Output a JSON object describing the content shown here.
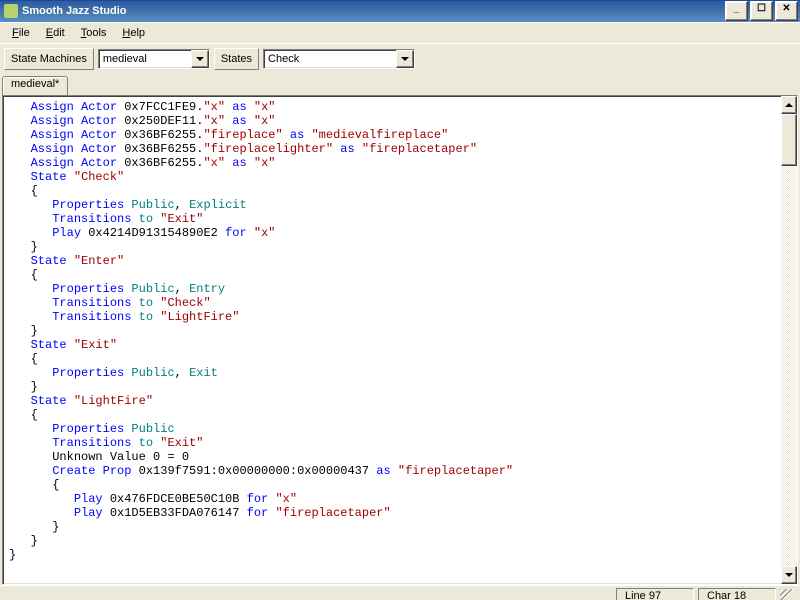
{
  "title": "Smooth Jazz Studio",
  "menus": {
    "file": "File",
    "edit": "Edit",
    "tools": "Tools",
    "help": "Help"
  },
  "toolbar": {
    "state_machines_label": "State Machines",
    "state_machines_value": "medieval",
    "states_label": "States",
    "states_value": "Check"
  },
  "tab": {
    "label": "medieval*"
  },
  "status": {
    "line": "Line 97",
    "char": "Char 18"
  },
  "code": {
    "l01a": "Assign Actor",
    "l01b": " 0x7FCC1FE9.",
    "l01c": "\"x\"",
    "l01d": " as ",
    "l01e": "\"x\"",
    "l02a": "Assign Actor",
    "l02b": " 0x250DEF11.",
    "l02c": "\"x\"",
    "l02d": " as ",
    "l02e": "\"x\"",
    "l03a": "Assign Actor",
    "l03b": " 0x36BF6255.",
    "l03c": "\"fireplace\"",
    "l03d": " as ",
    "l03e": "\"medievalfireplace\"",
    "l04a": "Assign Actor",
    "l04b": " 0x36BF6255.",
    "l04c": "\"fireplacelighter\"",
    "l04d": " as ",
    "l04e": "\"fireplacetaper\"",
    "l05a": "Assign Actor",
    "l05b": " 0x36BF6255.",
    "l05c": "\"x\"",
    "l05d": " as ",
    "l05e": "\"x\"",
    "l06a": "State",
    "l06b": " ",
    "l06c": "\"Check\"",
    "l07": "{",
    "l08a": "Properties",
    "l08b": " Public",
    "l08c": ", ",
    "l08d": "Explicit",
    "l09a": "Transitions",
    "l09b": " to ",
    "l09c": "\"Exit\"",
    "l10a": "Play",
    "l10b": " 0x4214D913154890E2 ",
    "l10c": "for",
    "l10d": " ",
    "l10e": "\"x\"",
    "l11": "}",
    "l12a": "State",
    "l12c": "\"Enter\"",
    "l13": "{",
    "l14a": "Properties",
    "l14b": " Public",
    "l14c": ", ",
    "l14d": "Entry",
    "l15a": "Transitions",
    "l15b": " to ",
    "l15c": "\"Check\"",
    "l16a": "Transitions",
    "l16b": " to ",
    "l16c": "\"LightFire\"",
    "l17": "}",
    "l18a": "State",
    "l18c": "\"Exit\"",
    "l19": "{",
    "l20a": "Properties",
    "l20b": " Public",
    "l20c": ", ",
    "l20d": "Exit",
    "l21": "}",
    "l22a": "State",
    "l22c": "\"LightFire\"",
    "l23": "{",
    "l24a": "Properties",
    "l24b": " Public",
    "l25a": "Transitions",
    "l25b": " to ",
    "l25c": "\"Exit\"",
    "l26": "Unknown Value 0 = 0",
    "l27a": "Create Prop",
    "l27b": " 0x139f7591:0x00000000:0x00000437",
    "l27d": " as ",
    "l27e": "\"fireplacetaper\"",
    "l28": "{",
    "l29a": "Play",
    "l29b": " 0x476FDCE0BE50C10B ",
    "l29c": "for",
    "l29e": "\"x\"",
    "l30a": "Play",
    "l30b": " 0x1D5EB33FDA076147 ",
    "l30c": "for",
    "l30e": "\"fireplacetaper\"",
    "l31": "}",
    "l32": "}",
    "l33": "}"
  }
}
